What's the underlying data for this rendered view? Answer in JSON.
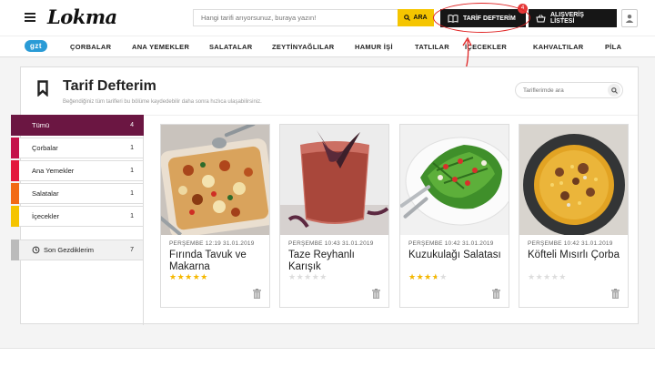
{
  "header": {
    "logo": "Lokma",
    "search_placeholder": "Hangi tarifi arıyorsunuz, buraya yazın!",
    "search_button": "ARA",
    "tarif_defteri": "TARİF DEFTERİM",
    "tarif_badge": "4",
    "shopping_list": "ALIŞVERİŞ LİSTESİ"
  },
  "nav": {
    "logo": "gzt",
    "items": [
      "ÇORBALAR",
      "ANA YEMEKLER",
      "SALATALAR",
      "ZEYTİNYAĞLILAR",
      "HAMUR İŞİ",
      "TATLILAR",
      "İÇECEKLER",
      "KAHVALTILAR",
      "PİLA"
    ]
  },
  "page": {
    "title": "Tarif Defterim",
    "subtitle": "Beğendiğiniz tüm tarifleri bu bölüme kaydedebilir daha sonra hızlıca ulaşabilirsiniz.",
    "search_placeholder": "Tariflerimde ara"
  },
  "sidebar": {
    "items": [
      {
        "label": "Tümü",
        "count": "4",
        "color": "#6b1642"
      },
      {
        "label": "Çorbalar",
        "count": "1",
        "color": "#c4124a"
      },
      {
        "label": "Ana Yemekler",
        "count": "1",
        "color": "#e3183d"
      },
      {
        "label": "Salatalar",
        "count": "1",
        "color": "#f26a16"
      },
      {
        "label": "İçecekler",
        "count": "1",
        "color": "#f5c400"
      }
    ],
    "recent": {
      "label": "Son Gezdiklerim",
      "count": "7"
    }
  },
  "recipes": [
    {
      "date": "PERŞEMBE 12:19 31.01.2019",
      "title": "Fırında Tavuk ve Makarna",
      "rating": 5,
      "stars": "★★★★★",
      "image": "baked-chicken-pasta"
    },
    {
      "date": "PERŞEMBE 10:43 31.01.2019",
      "title": "Taze Reyhanlı Karışık",
      "rating": 0,
      "stars": "★★★★★",
      "image": "basil-drink"
    },
    {
      "date": "PERŞEMBE 10:42 31.01.2019",
      "title": "Kuzukulağı Salatası",
      "rating": 3,
      "stars": "★★★★★",
      "image": "sorrel-salad"
    },
    {
      "date": "PERŞEMBE 10:42 31.01.2019",
      "title": "Köfteli Mısırlı Çorba",
      "rating": 0,
      "stars": "★★★★★",
      "image": "meatball-corn-soup"
    }
  ],
  "colors": {
    "accent": "#f5c500",
    "dark": "#161616",
    "active": "#6b1642",
    "star": "#f5b800",
    "highlight": "#e02424"
  }
}
